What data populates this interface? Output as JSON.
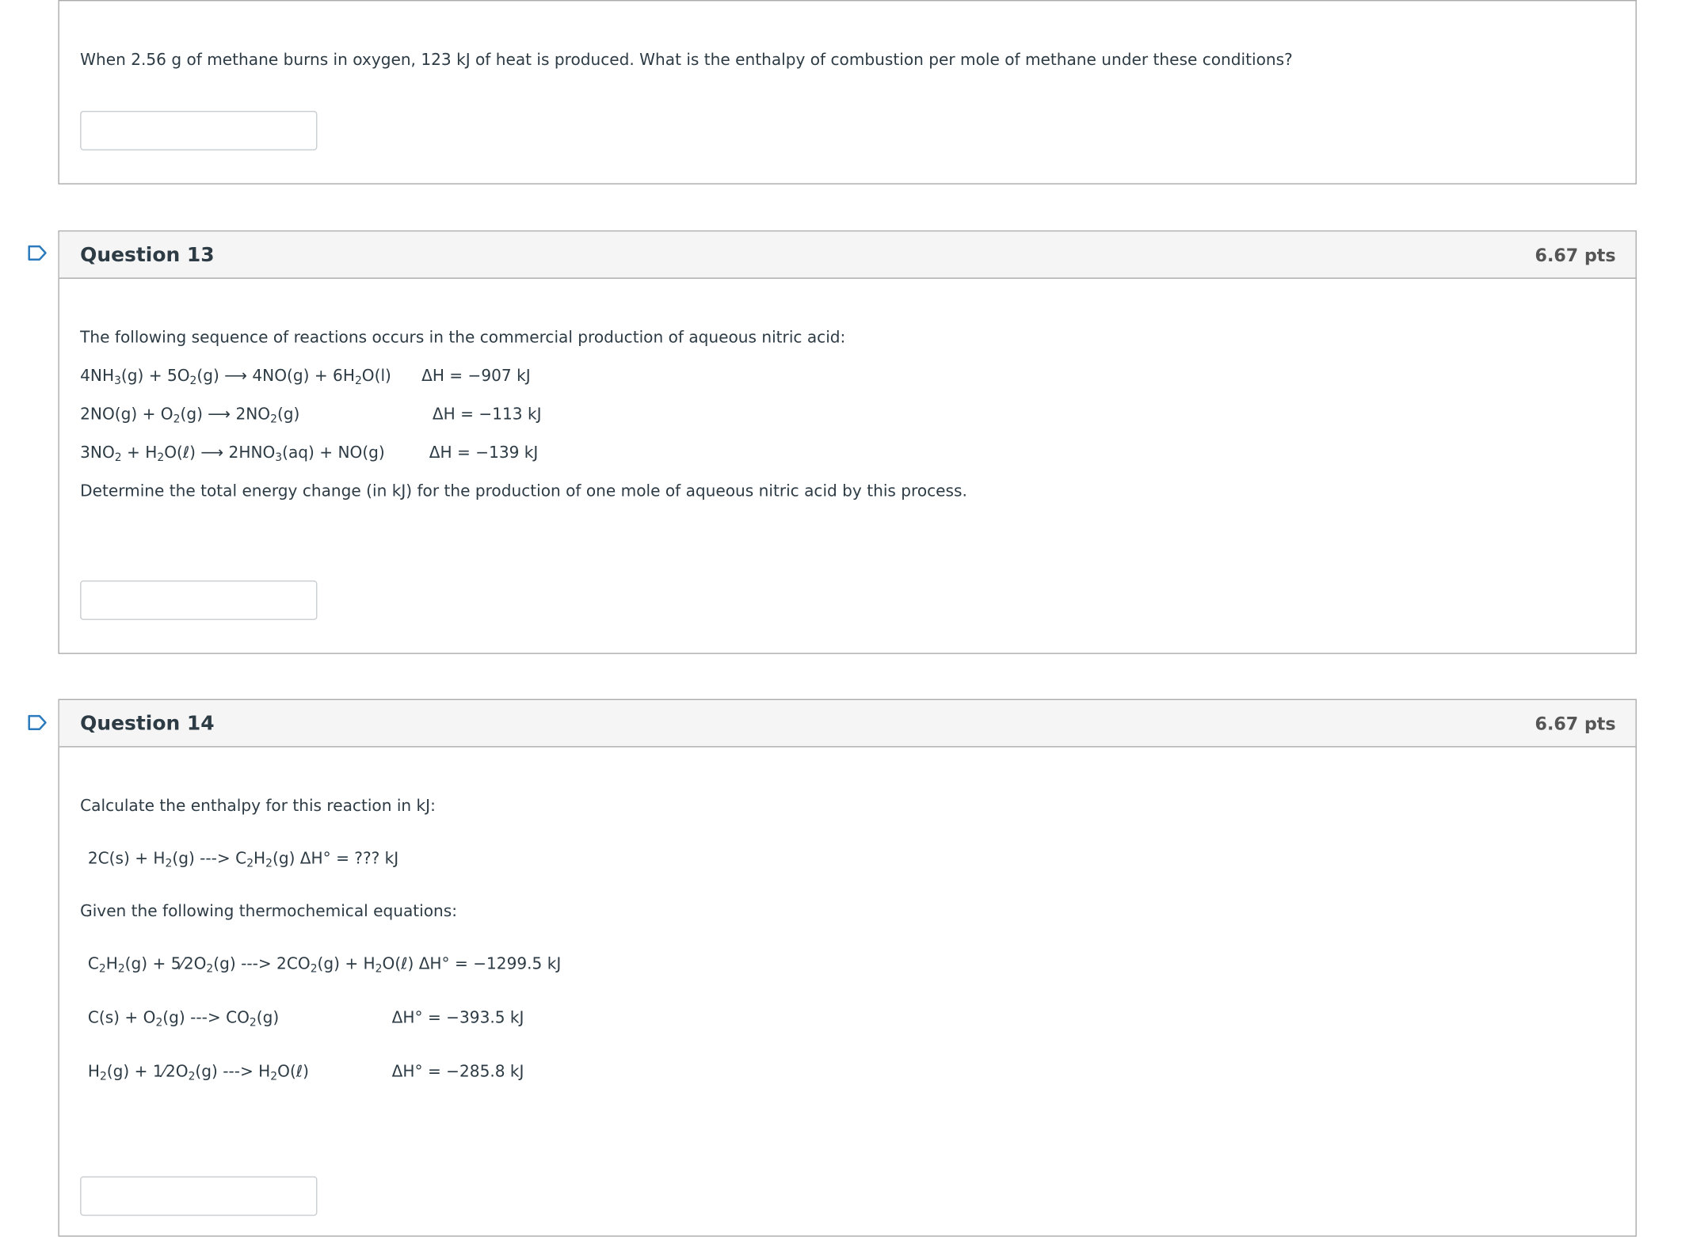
{
  "question12": {
    "prompt": "When  2.56 g of methane burns in oxygen,  123 kJ of heat is produced. What is the enthalpy of combustion per mole of methane under these conditions?",
    "answer_value": ""
  },
  "question13": {
    "title": "Question 13",
    "points": "6.67 pts",
    "flag_icon": "bookmark-flag-icon",
    "intro": "The following sequence of reactions occurs in the commercial production of aqueous nitric acid:",
    "reactions": [
      {
        "equation": "4NH3(g) + 5O2(g) ⟶ 4NO(g) + 6H2O(l)",
        "delta_h": "ΔH = −907 kJ"
      },
      {
        "equation": "2NO(g) + O2(g) ⟶ 2NO2(g)",
        "delta_h": "ΔH = −113 kJ"
      },
      {
        "equation": "3NO2 + H2O(ℓ) ⟶ 2HNO3(aq) + NO(g)",
        "delta_h": "ΔH = −139 kJ"
      }
    ],
    "question": "Determine the total energy change (in kJ) for the production of one mole of aqueous nitric acid by this process.",
    "answer_value": ""
  },
  "question14": {
    "title": "Question 14",
    "points": "6.67 pts",
    "flag_icon": "bookmark-flag-icon",
    "intro": "Calculate the enthalpy for this reaction in kJ:",
    "target_reaction": "2C(s) + H2(g) ---> C2H2(g) ΔH° = ??? kJ",
    "given_label": "Given the following thermochemical equations:",
    "equations": [
      {
        "equation": "C2H2(g) + 5⁄2O2(g) ---> 2CO2(g) + H2O(ℓ) ΔH° = −1299.5 kJ",
        "delta_h": ""
      },
      {
        "equation": "C(s) + O2(g) ---> CO2(g)",
        "delta_h": "ΔH° = −393.5 kJ"
      },
      {
        "equation": "H2(g) + 1⁄2O2(g) ---> H2O(ℓ)",
        "delta_h": "ΔH° = −285.8 kJ"
      }
    ],
    "answer_value": ""
  },
  "colors": {
    "flag_blue": "#2b7abc",
    "header_bg": "#f5f5f5",
    "border": "#aaaaaa",
    "text": "#2d3b45"
  }
}
